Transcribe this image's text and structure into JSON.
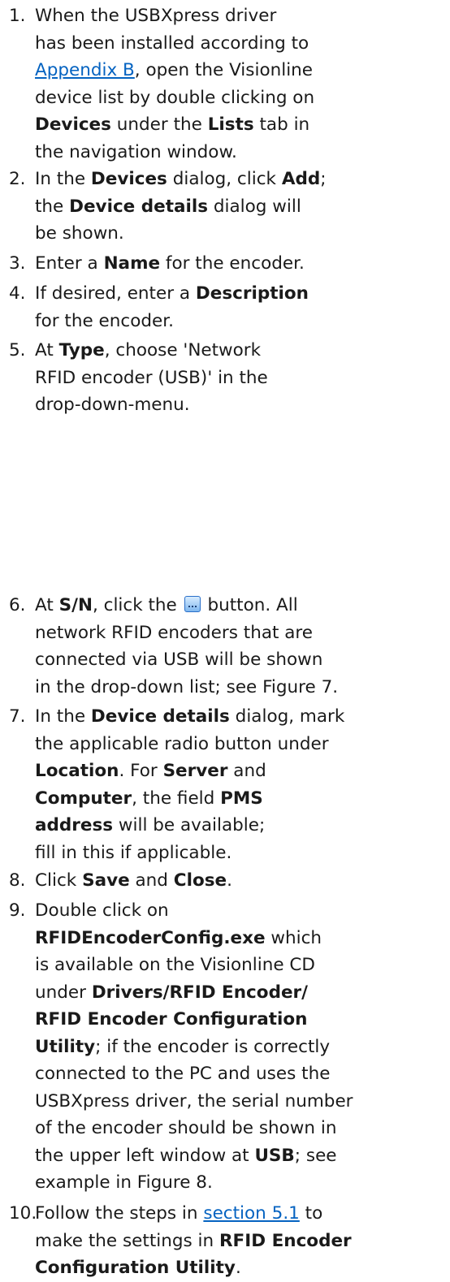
{
  "steps": [
    {
      "number": "1.",
      "lines": [
        [
          "When the USBXpress driver"
        ],
        [
          "has been installed according to"
        ],
        [
          "Appendix B",
          ", open the Visionline"
        ],
        [
          "device list by double clicking on"
        ],
        [
          "Devices",
          " under the ",
          "Lists",
          " tab in"
        ],
        [
          "the navigation window."
        ]
      ]
    },
    {
      "number": "2.",
      "lines": [
        [
          "In the ",
          "Devices",
          " dialog, click ",
          "Add",
          ";"
        ],
        [
          "the ",
          "Device details",
          " dialog will"
        ],
        [
          "be shown."
        ]
      ]
    },
    {
      "number": "3.",
      "lines": [
        [
          "Enter a ",
          "Name",
          " for the encoder."
        ]
      ]
    },
    {
      "number": "4.",
      "lines": [
        [
          "If desired, enter a ",
          "Description"
        ],
        [
          "for the encoder."
        ]
      ]
    },
    {
      "number": "5.",
      "lines": [
        [
          "At ",
          "Type",
          ", choose 'Network"
        ],
        [
          "RFID encoder (USB)' in the"
        ],
        [
          "drop-down-menu."
        ]
      ]
    },
    {
      "number": "6.",
      "lines": [
        [
          "At ",
          "S/N",
          ", click the ",
          " button. All"
        ],
        [
          "network RFID encoders that are"
        ],
        [
          "connected via USB will be shown"
        ],
        [
          "in the drop-down list; see Figure 7."
        ]
      ]
    },
    {
      "number": "7.",
      "lines": [
        [
          "In the ",
          "Device details",
          " dialog, mark"
        ],
        [
          "the applicable radio button under"
        ],
        [
          "Location",
          ". For ",
          "Server",
          " and"
        ],
        [
          "Computer",
          ", the field ",
          "PMS"
        ],
        [
          "address",
          " will be available;"
        ],
        [
          "fill in this if applicable."
        ]
      ]
    },
    {
      "number": "8.",
      "lines": [
        [
          "Click ",
          "Save",
          " and ",
          "Close",
          "."
        ]
      ]
    },
    {
      "number": "9.",
      "lines": [
        [
          "Double click on"
        ],
        [
          "RFIDEncoderConfig.exe",
          " which"
        ],
        [
          "is available on the Visionline CD"
        ],
        [
          "under ",
          "Drivers/RFID Encoder/"
        ],
        [
          "RFID Encoder Configuration"
        ],
        [
          "Utility",
          "; if the encoder is correctly"
        ],
        [
          "connected to the PC and uses the"
        ],
        [
          "USBXpress driver, the serial number"
        ],
        [
          "of the encoder should be shown in"
        ],
        [
          "the upper left window at ",
          "USB",
          "; see"
        ],
        [
          "example in Figure 8."
        ]
      ]
    },
    {
      "number": "10.",
      "lines": [
        [
          "Follow the steps in ",
          "section 5.1",
          " to"
        ],
        [
          "make the settings in ",
          "RFID Encoder"
        ],
        [
          "Configuration Utility",
          "."
        ]
      ]
    }
  ],
  "icons": {
    "browse_button": "ellipsis-button-icon"
  }
}
